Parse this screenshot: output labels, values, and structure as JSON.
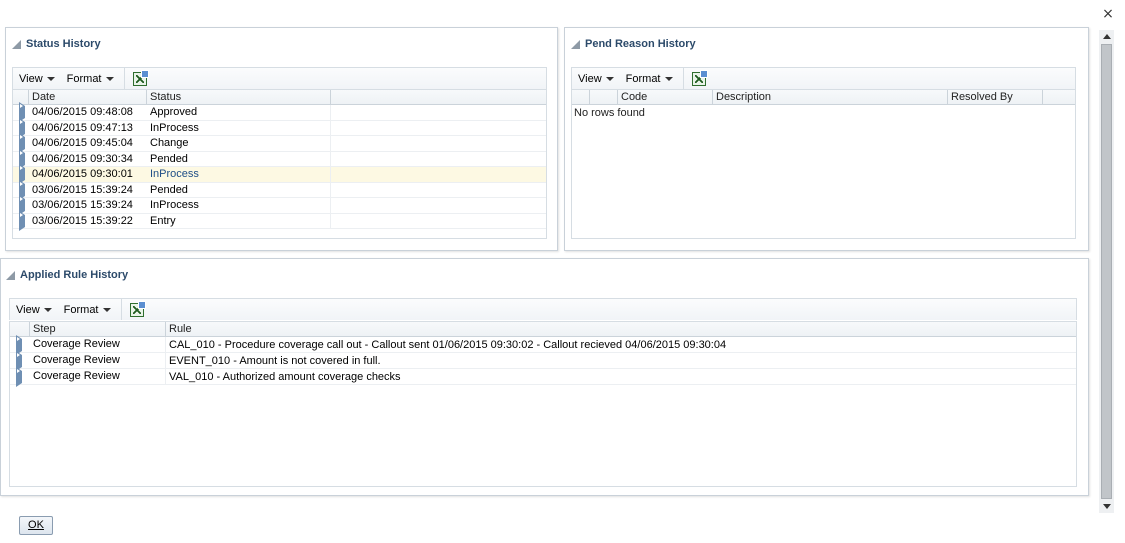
{
  "dialog": {
    "close_glyph": "×",
    "ok_label": "OK"
  },
  "status_history": {
    "title": "Status History",
    "toolbar": {
      "view_label": "View",
      "format_label": "Format",
      "export_icon": "excel-export-icon"
    },
    "columns": [
      "Date",
      "Status"
    ],
    "rows": [
      {
        "date": "04/06/2015  09:48:08",
        "status": "Approved"
      },
      {
        "date": "04/06/2015  09:47:13",
        "status": "InProcess"
      },
      {
        "date": "04/06/2015  09:45:04",
        "status": "Change"
      },
      {
        "date": "04/06/2015  09:30:34",
        "status": "Pended"
      },
      {
        "date": "04/06/2015  09:30:01",
        "status": "InProcess"
      },
      {
        "date": "03/06/2015  15:39:24",
        "status": "Pended"
      },
      {
        "date": "03/06/2015  15:39:24",
        "status": "InProcess"
      },
      {
        "date": "03/06/2015  15:39:22",
        "status": "Entry"
      }
    ]
  },
  "pend_reason_history": {
    "title": "Pend Reason History",
    "toolbar": {
      "view_label": "View",
      "format_label": "Format",
      "export_icon": "excel-export-icon"
    },
    "columns": [
      "Code",
      "Description",
      "Resolved By"
    ],
    "empty_text": "No rows found"
  },
  "applied_rule_history": {
    "title": "Applied Rule History",
    "toolbar": {
      "view_label": "View",
      "format_label": "Format",
      "export_icon": "excel-export-icon"
    },
    "columns": [
      "Step",
      "Rule"
    ],
    "rows": [
      {
        "step": "Coverage Review",
        "rule": "CAL_010 - Procedure coverage call out - Callout sent 01/06/2015 09:30:02 - Callout recieved 04/06/2015 09:30:04"
      },
      {
        "step": "Coverage Review",
        "rule": "EVENT_010 -  Amount is not covered in full."
      },
      {
        "step": "Coverage Review",
        "rule": "VAL_010 - Authorized amount coverage checks"
      }
    ]
  },
  "colors": {
    "title_text": "#2c4a6a",
    "selected_row": "#fdf9e3",
    "expand_icon": "#6f8fb3"
  }
}
